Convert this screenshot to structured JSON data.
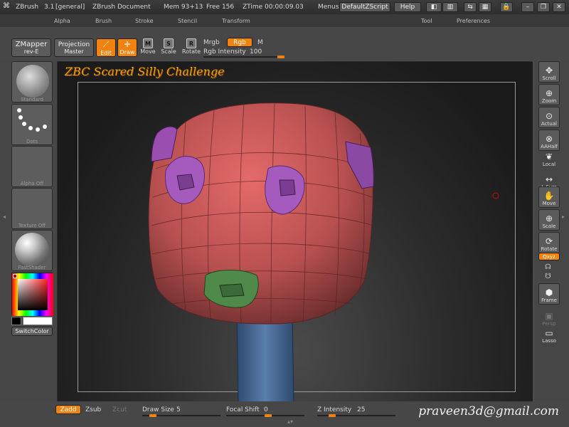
{
  "titlebar": {
    "app": "ZBrush",
    "version": "3.1",
    "layout": "[general]",
    "document": "ZBrush Document",
    "mem": "Mem 93+13",
    "free": "Free 156",
    "ztime": "ZTime 00:00:09.03",
    "menus": "Menus",
    "script": "DefaultZScript",
    "help": "Help"
  },
  "menubar": [
    "Alpha",
    "Brush",
    "Stroke",
    "Stencil",
    "Transform",
    "Tool",
    "Preferences"
  ],
  "topshelf": {
    "zmapper": "ZMapper",
    "zmapper_sub": "rev-E",
    "projection": "Projection",
    "projection_sub": "Master",
    "edit": "Edit",
    "draw": "Draw",
    "move": "Move",
    "scale": "Scale",
    "rotate": "Rotate",
    "mrgb": "Mrgb",
    "rgb": "Rgb",
    "m": "M",
    "rgb_intensity_label": "Rgb Intensity",
    "rgb_intensity_value": "100"
  },
  "lefttray": {
    "standard": "Standard",
    "dots": "Dots",
    "alpha_off": "Alpha Off",
    "texture_off": "Texture Off",
    "fastshader": "FastShader",
    "switchcolor": "SwitchColor"
  },
  "righttray": {
    "scroll": "Scroll",
    "zoom": "Zoom",
    "actual": "Actual",
    "aahalf": "AAHalf",
    "local": "Local",
    "lsym": "L.Sym",
    "move": "Move",
    "scale": "Scale",
    "rotate": "Rotate",
    "xyz": "Qxyz",
    "frame": "Frame",
    "persp": "Persp",
    "lasso": "Lasso"
  },
  "canvas": {
    "title": "ZBC Scared Silly Challenge"
  },
  "bottombar": {
    "zadd": "Zadd",
    "zsub": "Zsub",
    "zcut": "Zcut",
    "draw_size_label": "Draw Size",
    "draw_size_value": "5",
    "focal_shift_label": "Focal Shift",
    "focal_shift_value": "0",
    "z_intensity_label": "Z Intensity",
    "z_intensity_value": "25",
    "signature": "praveen3d@gmail.com"
  },
  "colors": {
    "accent": "#f0820f",
    "mesh_red": "#c9595a",
    "mesh_purple": "#a45bbd",
    "mesh_green": "#4f8a4a",
    "neck_blue": "#4a6e9a"
  }
}
